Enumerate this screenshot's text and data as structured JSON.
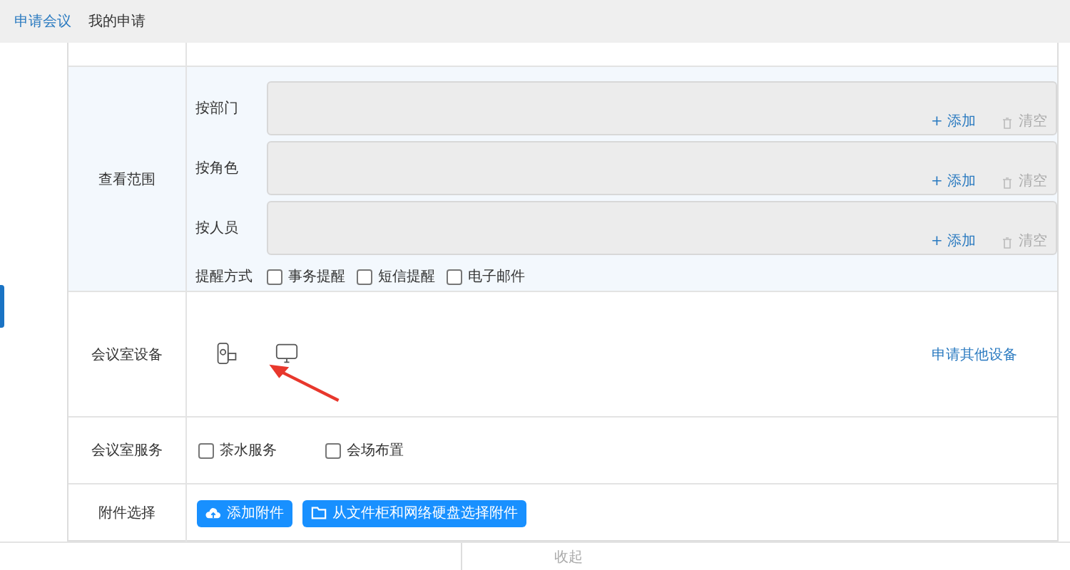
{
  "tabs": [
    {
      "label": "申请会议",
      "selected": true
    },
    {
      "label": "我的申请",
      "selected": false
    }
  ],
  "scope": {
    "label": "查看范围",
    "fields": [
      {
        "label": "按部门",
        "add": "+ 添加",
        "clear": "清空"
      },
      {
        "label": "按角色",
        "add": "+ 添加",
        "clear": "清空"
      },
      {
        "label": "按人员",
        "add": "+ 添加",
        "clear": "清空"
      }
    ],
    "remind": {
      "label": "提醒方式",
      "options": [
        {
          "label": "事务提醒",
          "checked": false
        },
        {
          "label": "短信提醒",
          "checked": false
        },
        {
          "label": "电子邮件",
          "checked": false
        }
      ]
    }
  },
  "equipment": {
    "label": "会议室设备",
    "devices": [
      {
        "kind": "camera"
      },
      {
        "kind": "monitor"
      }
    ],
    "other_link": "申请其他设备"
  },
  "services": {
    "label": "会议室服务",
    "options": [
      {
        "label": "茶水服务",
        "checked": false
      },
      {
        "label": "会场布置",
        "checked": false
      }
    ]
  },
  "attachments": {
    "label": "附件选择",
    "buttons": [
      {
        "kind": "upload",
        "label": "添加附件"
      },
      {
        "kind": "folder",
        "label": "从文件柜和网络硬盘选择附件"
      }
    ]
  },
  "collapse": "收起"
}
